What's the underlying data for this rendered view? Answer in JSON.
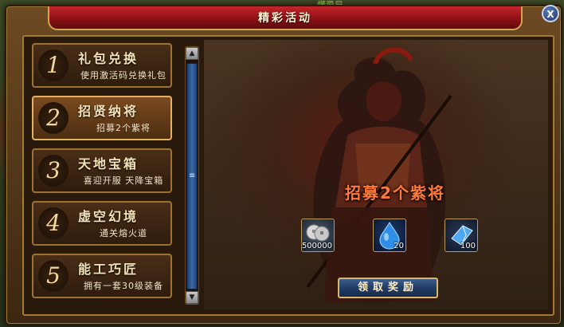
{
  "window": {
    "title": "精彩活动",
    "close_label": "X"
  },
  "scene": {
    "top_name": "懂爱局"
  },
  "activities": [
    {
      "num": "1",
      "title": "礼包兑换",
      "desc": "使用激活码兑换礼包",
      "active": false
    },
    {
      "num": "2",
      "title": "招贤纳将",
      "desc": "招募2个紫将",
      "active": true
    },
    {
      "num": "3",
      "title": "天地宝箱",
      "desc": "喜迎开服  天降宝箱",
      "active": false
    },
    {
      "num": "4",
      "title": "虚空幻境",
      "desc": "通关熔火道",
      "active": false
    },
    {
      "num": "5",
      "title": "能工巧匠",
      "desc": "拥有一套30级装备",
      "active": false
    }
  ],
  "scroll": {
    "up_icon": "▲",
    "down_icon": "▼",
    "grip": "≡"
  },
  "detail": {
    "heading": "招募2个紫将",
    "rewards": [
      {
        "icon": "coins-icon",
        "count": "500000"
      },
      {
        "icon": "blue-drop-icon",
        "count": "20"
      },
      {
        "icon": "crystal-icon",
        "count": "100"
      }
    ],
    "claim_label": "领取奖励"
  }
}
